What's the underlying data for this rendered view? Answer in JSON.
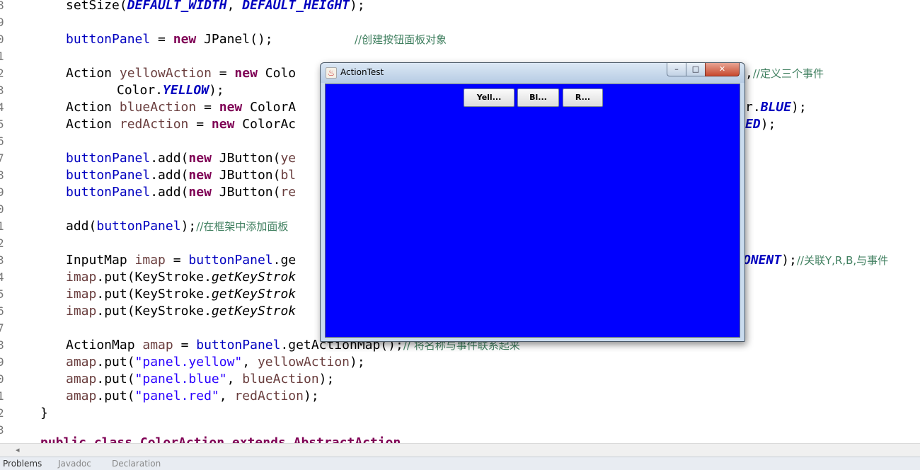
{
  "editor": {
    "line_numbers": [
      "8",
      "9",
      "0",
      "1",
      "2",
      "3",
      "4",
      "5",
      "6",
      "7",
      "8",
      "9",
      "0",
      "1",
      "2",
      "3",
      "4",
      "5",
      "6",
      "7",
      "8",
      "9",
      "0",
      "1",
      "2",
      "3"
    ],
    "code": {
      "l1": [
        "setSize(",
        "DEFAULT_WIDTH",
        ", ",
        "DEFAULT_HEIGHT",
        ");"
      ],
      "l3": [
        "buttonPanel",
        " = ",
        "new",
        " JPanel();",
        "//创建按钮面板对象"
      ],
      "l5": [
        "Action ",
        "yellowAction",
        " = ",
        "new",
        " Colo",
        ",",
        "//定义三个事件"
      ],
      "l6": [
        "Color.",
        "YELLOW",
        ");"
      ],
      "l7": [
        "Action ",
        "blueAction",
        " = ",
        "new",
        " ColorA",
        "r.",
        "BLUE",
        ");"
      ],
      "l8": [
        "Action ",
        "redAction",
        " = ",
        "new",
        " ColorAc",
        "ED",
        ");"
      ],
      "l10": [
        "buttonPanel",
        ".add(",
        "new",
        " JButton(",
        "ye"
      ],
      "l11": [
        "buttonPanel",
        ".add(",
        "new",
        " JButton(",
        "bl"
      ],
      "l12": [
        "buttonPanel",
        ".add(",
        "new",
        " JButton(",
        "re"
      ],
      "l14": [
        "add(",
        "buttonPanel",
        ");",
        "//在框架中添加面板"
      ],
      "l16": [
        "InputMap ",
        "imap",
        " = ",
        "buttonPanel",
        ".ge",
        "ONENT",
        ");",
        "//关联Y,R,B,与事件"
      ],
      "l17": [
        "imap",
        ".put(KeyStroke.",
        "getKeyStrok"
      ],
      "l18": [
        "imap",
        ".put(KeyStroke.",
        "getKeyStrok"
      ],
      "l19": [
        "imap",
        ".put(KeyStroke.",
        "getKeyStrok"
      ],
      "l21": [
        "ActionMap ",
        "amap",
        " = ",
        "buttonPanel",
        ".getActionMap();",
        "// 将名称与事件联系起来"
      ],
      "l22": [
        "amap",
        ".put(",
        "\"panel.yellow\"",
        ", ",
        "yellowAction",
        ");"
      ],
      "l23": [
        "amap",
        ".put(",
        "\"panel.blue\"",
        ", ",
        "blueAction",
        ");"
      ],
      "l24": [
        "amap",
        ".put(",
        "\"panel.red\"",
        ", ",
        "redAction",
        ");"
      ],
      "l25": [
        "}"
      ],
      "l27": [
        "public class ColorAction extends AbstractAction"
      ]
    }
  },
  "bottom_tabs": {
    "tab1": "Problems",
    "tab2": "Javadoc",
    "tab3": "Declaration"
  },
  "window": {
    "title": "ActionTest",
    "min_glyph": "–",
    "max_glyph": "□",
    "close_glyph": "✕",
    "java_icon": "♨",
    "body_color": "#0000ff",
    "buttons": [
      "Yell...",
      "Bl...",
      "R..."
    ]
  }
}
